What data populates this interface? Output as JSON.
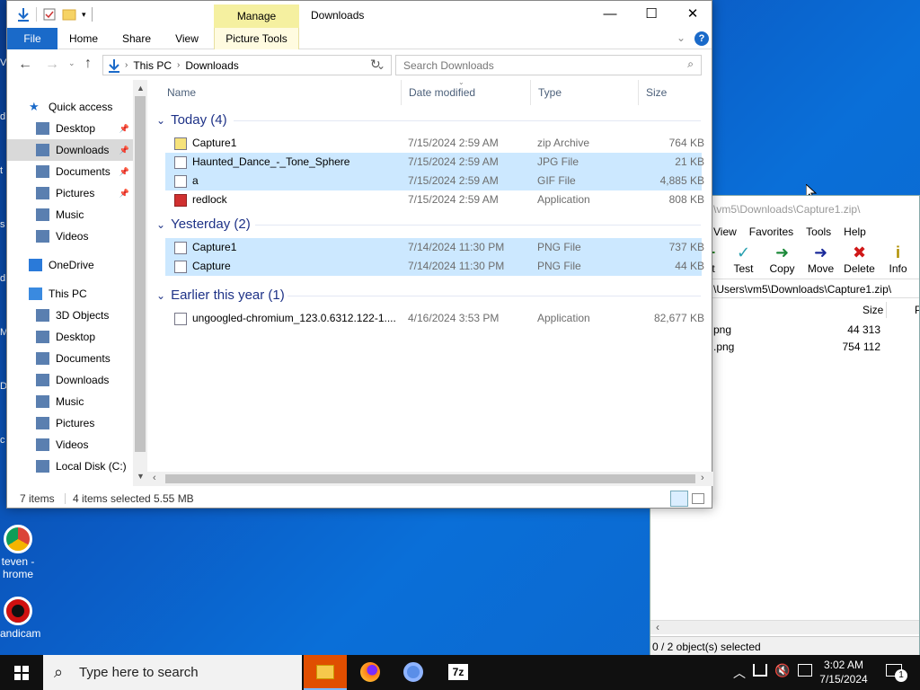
{
  "desktop": {
    "icons": [
      {
        "label_line1": "teven -",
        "label_line2": "hrome"
      },
      {
        "label_line1": "andicam",
        "label_line2": ""
      }
    ],
    "left_edge_letters": [
      "V",
      "d",
      "t",
      "s",
      "d",
      "M",
      "D",
      "c"
    ]
  },
  "zip_window": {
    "title": "\\vm5\\Downloads\\Capture1.zip\\",
    "menu": [
      "View",
      "Favorites",
      "Tools",
      "Help"
    ],
    "toolbar": [
      {
        "label": "ct",
        "glyph": "+",
        "color": "#2a8a2a"
      },
      {
        "label": "Test",
        "glyph": "✓",
        "color": "#28a0b0"
      },
      {
        "label": "Copy",
        "glyph": "➜",
        "color": "#1c8a3a"
      },
      {
        "label": "Move",
        "glyph": "➜",
        "color": "#1a2a9a"
      },
      {
        "label": "Delete",
        "glyph": "✖",
        "color": "#d01818"
      },
      {
        "label": "Info",
        "glyph": "i",
        "color": "#b09000"
      }
    ],
    "address": "\\Users\\vm5\\Downloads\\Capture1.zip\\",
    "col_size": "Size",
    "col_p": "P",
    "rows": [
      {
        "name": "png",
        "size": "44 313"
      },
      {
        "name": ".png",
        "size": "754 112"
      }
    ],
    "status": "0 / 2 object(s) selected"
  },
  "explorer": {
    "title": "Downloads",
    "manage_label": "Manage",
    "tabs": {
      "file": "File",
      "home": "Home",
      "share": "Share",
      "view": "View",
      "picture_tools": "Picture Tools"
    },
    "address": {
      "this_pc": "This PC",
      "downloads": "Downloads"
    },
    "search_placeholder": "Search Downloads",
    "columns": {
      "name": "Name",
      "date": "Date modified",
      "type": "Type",
      "size": "Size"
    },
    "nav": [
      {
        "label": "Quick access",
        "pinned": false
      },
      {
        "label": "Desktop",
        "pinned": true
      },
      {
        "label": "Downloads",
        "pinned": true
      },
      {
        "label": "Documents",
        "pinned": true
      },
      {
        "label": "Pictures",
        "pinned": true
      },
      {
        "label": "Music",
        "pinned": false
      },
      {
        "label": "Videos",
        "pinned": false
      },
      {
        "label": "OneDrive",
        "pinned": false
      },
      {
        "label": "This PC",
        "pinned": false
      },
      {
        "label": "3D Objects",
        "pinned": false
      },
      {
        "label": "Desktop",
        "pinned": false
      },
      {
        "label": "Documents",
        "pinned": false
      },
      {
        "label": "Downloads",
        "pinned": false
      },
      {
        "label": "Music",
        "pinned": false
      },
      {
        "label": "Pictures",
        "pinned": false
      },
      {
        "label": "Videos",
        "pinned": false
      },
      {
        "label": "Local Disk (C:)",
        "pinned": false
      }
    ],
    "groups": [
      {
        "label": "Today (4)",
        "files": [
          {
            "name": "Capture1",
            "date": "7/15/2024 2:59 AM",
            "type": "zip Archive",
            "size": "764 KB",
            "selected": false,
            "icon": "zip"
          },
          {
            "name": "Haunted_Dance_-_Tone_Sphere",
            "date": "7/15/2024 2:59 AM",
            "type": "JPG File",
            "size": "21 KB",
            "selected": true,
            "icon": "img"
          },
          {
            "name": "a",
            "date": "7/15/2024 2:59 AM",
            "type": "GIF File",
            "size": "4,885 KB",
            "selected": true,
            "icon": "img"
          },
          {
            "name": "redlock",
            "date": "7/15/2024 2:59 AM",
            "type": "Application",
            "size": "808 KB",
            "selected": false,
            "icon": "app"
          }
        ]
      },
      {
        "label": "Yesterday (2)",
        "files": [
          {
            "name": "Capture1",
            "date": "7/14/2024 11:30 PM",
            "type": "PNG File",
            "size": "737 KB",
            "selected": true,
            "icon": "img"
          },
          {
            "name": "Capture",
            "date": "7/14/2024 11:30 PM",
            "type": "PNG File",
            "size": "44 KB",
            "selected": true,
            "icon": "img"
          }
        ]
      },
      {
        "label": "Earlier this year (1)",
        "files": [
          {
            "name": "ungoogled-chromium_123.0.6312.122-1....",
            "date": "4/16/2024 3:53 PM",
            "type": "Application",
            "size": "82,677 KB",
            "selected": false,
            "icon": "exe"
          }
        ]
      }
    ],
    "status": {
      "items": "7 items",
      "selected": "4 items selected",
      "size": "5.55 MB"
    }
  },
  "taskbar": {
    "search_placeholder": "Type here to search",
    "time": "3:02 AM",
    "date": "7/15/2024",
    "notification_count": "1",
    "apps": [
      "file-explorer",
      "firefox",
      "chromium",
      "7zip"
    ]
  }
}
